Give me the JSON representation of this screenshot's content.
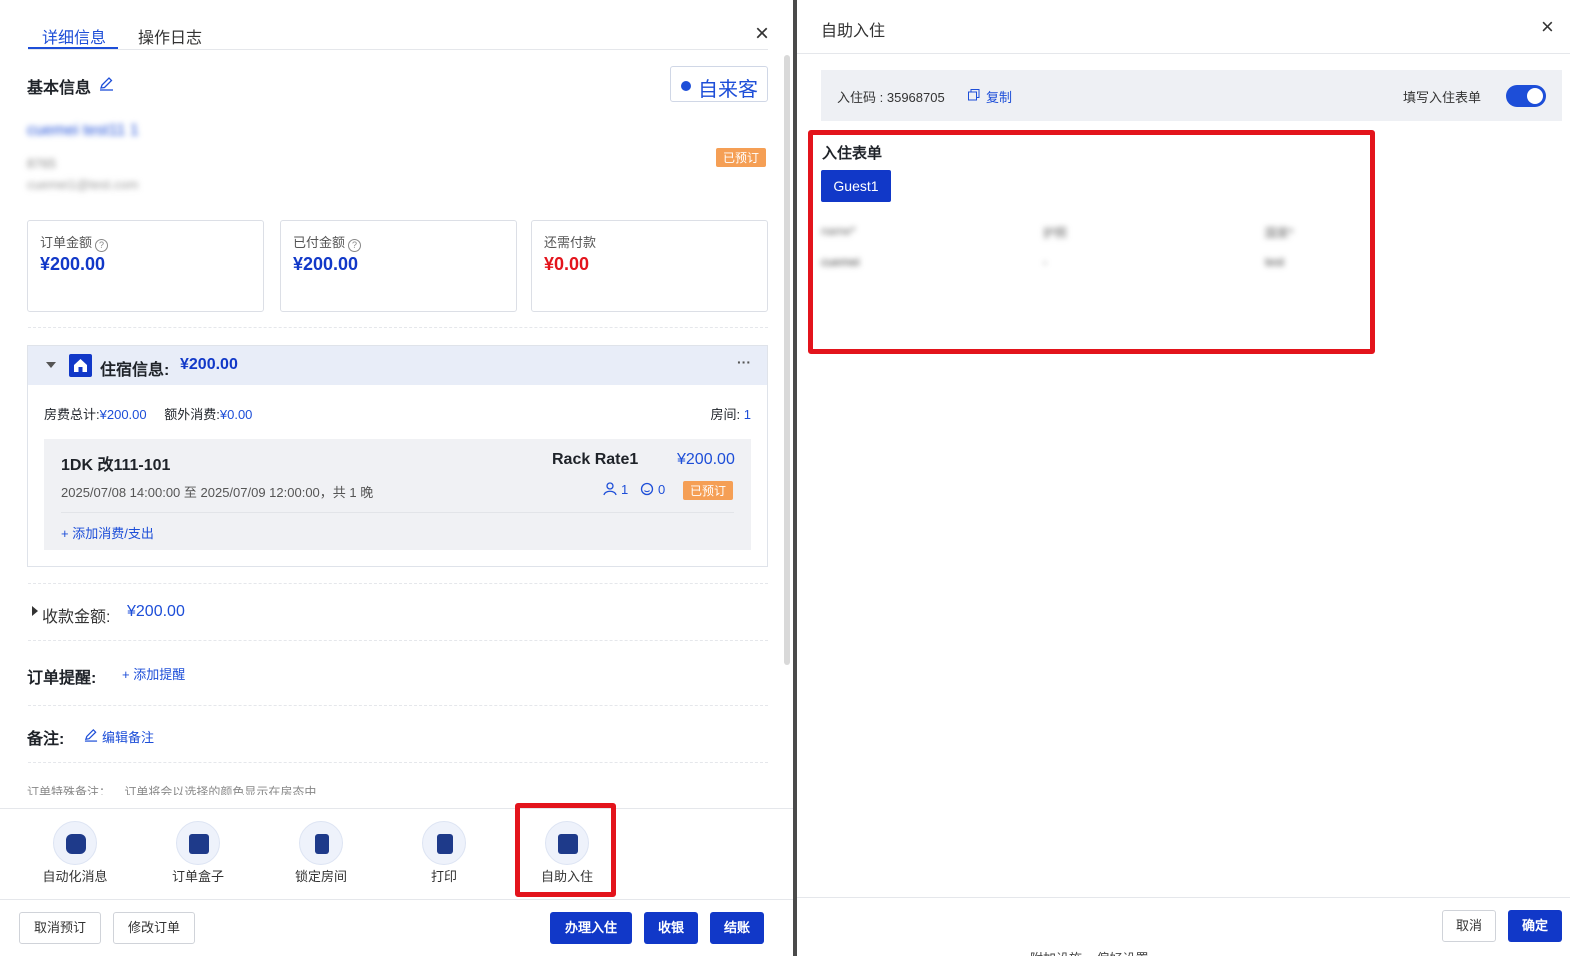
{
  "left": {
    "tabs": [
      "详细信息",
      "操作日志"
    ],
    "close_icon": "×",
    "basic_info_title": "基本信息",
    "guest_source_label": "自来客",
    "guest_name": "cuemei test11 1",
    "guest_phone": "8765",
    "guest_email": "cuemei1@test.com",
    "booked_badge": "已预订",
    "cards": [
      {
        "label": "订单金额",
        "value": "¥200.00",
        "color": "#1138c8"
      },
      {
        "label": "已付金额",
        "value": "¥200.00",
        "color": "#1138c8"
      },
      {
        "label": "还需付款",
        "value": "¥0.00",
        "color": "#e3141c"
      }
    ],
    "stay": {
      "title": "住宿信息:",
      "amount": "¥200.00",
      "more_icon": "···",
      "room_total_label": "房费总计:",
      "room_total_value": "¥200.00",
      "extra_label": "额外消费:",
      "extra_value": "¥0.00",
      "rooms_label": "房间:",
      "rooms_value": "1",
      "room_name": "1DK 改111-101",
      "rate_name": "Rack Rate1",
      "room_price": "¥200.00",
      "dates": "2025/07/08 14:00:00 至 2025/07/09 12:00:00，共 1 晚",
      "adults": "1",
      "children": "0",
      "room_badge": "已预订",
      "add_expense": "添加消费/支出"
    },
    "payment_label": "收款金额:",
    "payment_value": "¥200.00",
    "reminder_label": "订单提醒:",
    "add_reminder": "添加提醒",
    "remark_label": "备注:",
    "edit_remark": "编辑备注",
    "cutoff_text": "订单特殊备注：    订单将会以选择的颜色显示在房态中",
    "bottom_icons": [
      "自动化消息",
      "订单盒子",
      "锁定房间",
      "打印",
      "自助入住"
    ],
    "actions_left": [
      "取消预订",
      "修改订单"
    ],
    "actions_right": [
      "办理入住",
      "收银",
      "结账"
    ]
  },
  "right": {
    "title": "自助入住",
    "close_icon": "×",
    "checkin_code_label": "入住码",
    "checkin_code": "35968705",
    "copy_label": "复制",
    "fill_form_label": "填写入住表单",
    "form_title": "入住表单",
    "guest_tab": "Guest1",
    "table_headers": [
      "name*",
      "护照",
      "国家*"
    ],
    "table_row": [
      "cuemei",
      "-",
      "test"
    ],
    "cancel": "取消",
    "confirm": "确定",
    "below_text": "附加设施    偏好设置"
  },
  "colors": {
    "primary": "#1138c8",
    "link": "#1d4ed8",
    "danger": "#e3141c",
    "warning": "#f59f55"
  }
}
